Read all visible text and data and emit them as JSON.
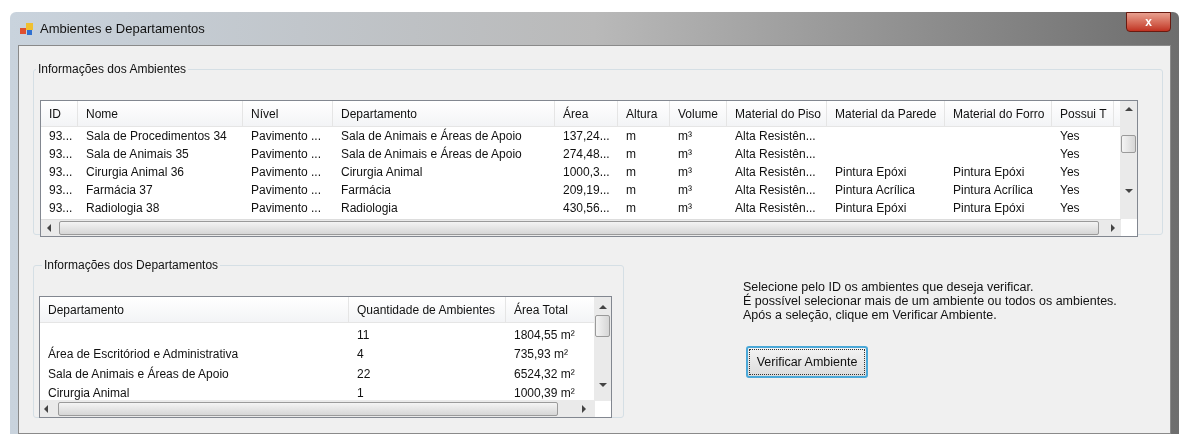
{
  "window": {
    "title": "Ambientes e Departamentos",
    "close": "x"
  },
  "ambientes": {
    "title": "Informações dos Ambientes",
    "columns": [
      "ID",
      "Nome",
      "Nível",
      "Departamento",
      "Área",
      "Altura",
      "Volume",
      "Material do Piso",
      "Material da Parede",
      "Material do Forro",
      "Possui T"
    ],
    "rows": [
      [
        "93...",
        "Sala de Procedimentos 34",
        "Pavimento ...",
        "Sala de Animais e Áreas de Apoio",
        "137,24...",
        "m",
        "m³",
        "Alta Resistên...",
        "",
        "",
        "Yes"
      ],
      [
        "93...",
        "Sala de Animais 35",
        "Pavimento ...",
        "Sala de Animais e Áreas de Apoio",
        "274,48...",
        "m",
        "m³",
        "Alta Resistên...",
        "",
        "",
        "Yes"
      ],
      [
        "93...",
        "Cirurgia Animal 36",
        "Pavimento ...",
        "Cirurgia Animal",
        "1000,3...",
        "m",
        "m³",
        "Alta Resistên...",
        "Pintura Epóxi",
        "Pintura Epóxi",
        "Yes"
      ],
      [
        "93...",
        "Farmácia 37",
        "Pavimento ...",
        "Farmácia",
        "209,19...",
        "m",
        "m³",
        "Alta Resistên...",
        "Pintura Acrílica",
        "Pintura Acrílica",
        "Yes"
      ],
      [
        "93...",
        "Radiologia 38",
        "Pavimento ...",
        "Radiologia",
        "430,56...",
        "m",
        "m³",
        "Alta Resistên...",
        "Pintura Epóxi",
        "Pintura Epóxi",
        "Yes"
      ]
    ]
  },
  "departamentos": {
    "title": "Informações dos Departamentos",
    "columns": [
      "Departamento",
      "Quantidade de Ambientes",
      "Área Total"
    ],
    "rows": [
      [
        "",
        "11",
        "1804,55 m²"
      ],
      [
        "Área de Escritóriod e Administrativa",
        "4",
        "735,93 m²"
      ],
      [
        "Sala de Animais e Áreas de Apoio",
        "22",
        "6524,32 m²"
      ],
      [
        "Cirurgia Animal",
        "1",
        "1000,39 m²"
      ]
    ]
  },
  "instructions": [
    "Selecione pelo ID os ambientes que deseja verificar.",
    "É possível selecionar mais de um ambiente ou todos os ambientes.",
    "Após a seleção, clique em Verificar Ambiente."
  ],
  "button": "Verificar Ambiente"
}
